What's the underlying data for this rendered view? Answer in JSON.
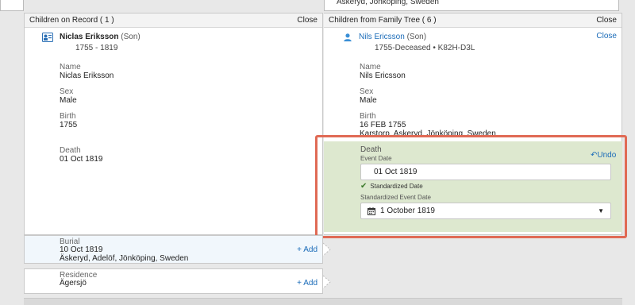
{
  "top": {
    "right_text": "Äskeryd, Jönköping, Sweden"
  },
  "left_panel": {
    "title": "Children on Record ( 1 )",
    "close_label": "Close",
    "person": {
      "name": "Niclas Eriksson",
      "relation": "(Son)",
      "dates": "1755 - 1819"
    },
    "name_label": "Name",
    "name_value": "Niclas Eriksson",
    "sex_label": "Sex",
    "sex_value": "Male",
    "birth_label": "Birth",
    "birth_value": "1755",
    "death_label": "Death",
    "death_value": "01 Oct 1819"
  },
  "right_panel": {
    "title": "Children from Family Tree ( 6 )",
    "close_label": "Close",
    "close_link_label": "Close",
    "person": {
      "name": "Nils Ericsson",
      "relation": "(Son)",
      "dates": "1755-Deceased • K82H-D3L"
    },
    "name_label": "Name",
    "name_value": "Nils Ericsson",
    "sex_label": "Sex",
    "sex_value": "Male",
    "birth_label": "Birth",
    "birth_date": "16 FEB 1755",
    "birth_place": "Karstorp, Askeryd, Jönköping, Sweden"
  },
  "death_edit": {
    "title": "Death",
    "undo_label": "Undo",
    "event_date_label": "Event Date",
    "event_date_value": "01 Oct 1819",
    "standardized_label": "Standardized Date",
    "std_event_date_label": "Standardized Event Date",
    "std_event_date_value": "1 October 1819"
  },
  "burial": {
    "label": "Burial",
    "date": "10 Oct 1819",
    "place": "Äskeryd, Adelöf, Jönköping, Sweden",
    "add_label": "+ Add"
  },
  "residence": {
    "label": "Residence",
    "place": "Ägersjö",
    "add_label": "+ Add"
  },
  "colors": {
    "highlight_border": "#e06a55",
    "edit_bg": "#dde8cf",
    "link": "#1a6bb8"
  }
}
